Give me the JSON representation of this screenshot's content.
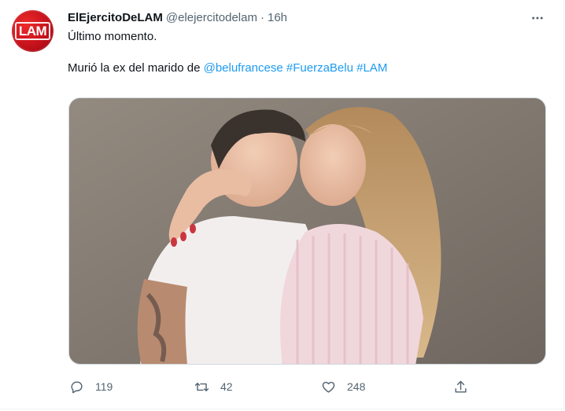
{
  "tweet": {
    "display_name": "ElEjercitoDeLAM",
    "handle": "@elejercitodelam",
    "separator": "·",
    "time": "16h",
    "avatar_text": "LAM",
    "line1": "Último momento.",
    "line2_prefix": "Murió la ex del marido de",
    "mention": "@belufrancese",
    "hashtag1": "#FuerzaBelu",
    "hashtag2": "#LAM",
    "media_icon": "photo"
  },
  "actions": {
    "reply_count": "119",
    "retweet_count": "42",
    "like_count": "248",
    "reply_icon": "reply-icon",
    "retweet_icon": "retweet-icon",
    "like_icon": "heart-icon",
    "share_icon": "share-icon"
  },
  "colors": {
    "link": "#1d9bf0",
    "secondary_text": "#536471",
    "avatar_red": "#c1101a"
  }
}
